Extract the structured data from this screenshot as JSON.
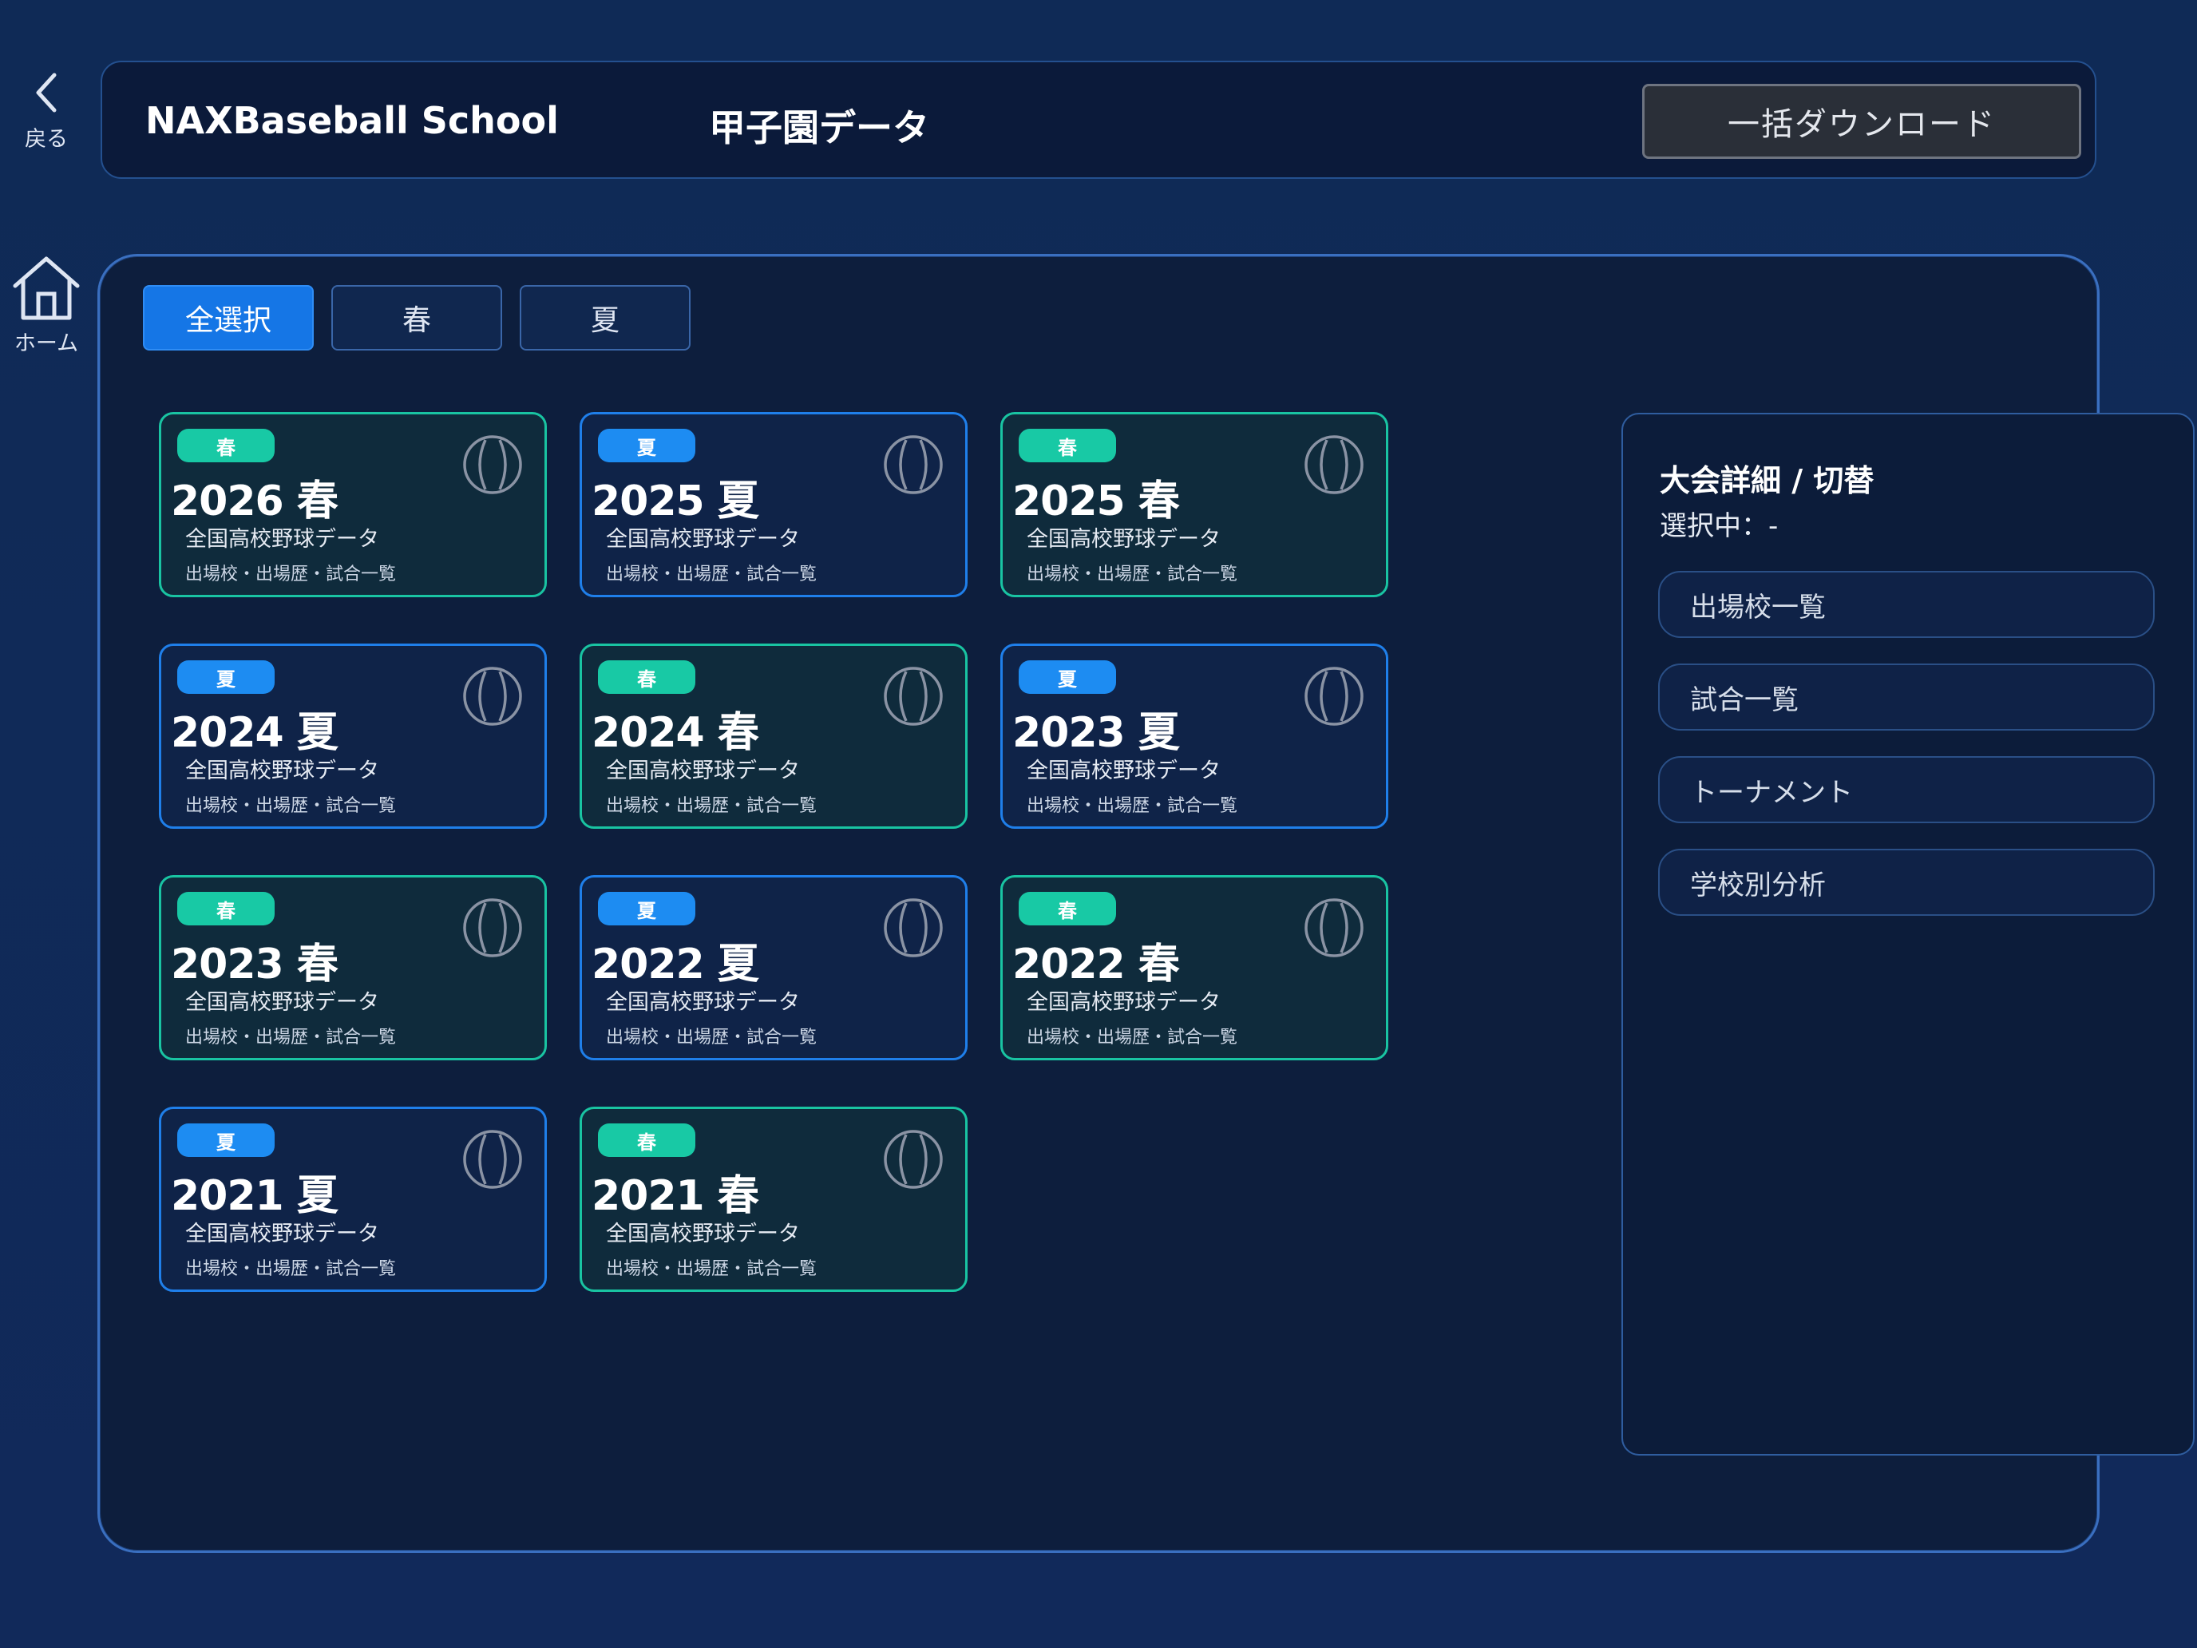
{
  "nav": {
    "back_label": "戻る",
    "home_label": "ホーム"
  },
  "header": {
    "brand": "NAXBaseball School",
    "title": "甲子園データ",
    "download_label": "一括ダウンロード"
  },
  "filters": {
    "all": "全選択",
    "spring": "春",
    "summer": "夏",
    "active": "all"
  },
  "cards": [
    {
      "badge": "春",
      "title": "2026 春",
      "season": "spring",
      "subtitle": "全国高校野球データ",
      "meta": "出場校・出場歴・試合一覧"
    },
    {
      "badge": "夏",
      "title": "2025 夏",
      "season": "summer",
      "subtitle": "全国高校野球データ",
      "meta": "出場校・出場歴・試合一覧"
    },
    {
      "badge": "春",
      "title": "2025 春",
      "season": "spring",
      "subtitle": "全国高校野球データ",
      "meta": "出場校・出場歴・試合一覧"
    },
    {
      "badge": "夏",
      "title": "2024 夏",
      "season": "summer",
      "subtitle": "全国高校野球データ",
      "meta": "出場校・出場歴・試合一覧"
    },
    {
      "badge": "春",
      "title": "2024 春",
      "season": "spring",
      "subtitle": "全国高校野球データ",
      "meta": "出場校・出場歴・試合一覧"
    },
    {
      "badge": "夏",
      "title": "2023 夏",
      "season": "summer",
      "subtitle": "全国高校野球データ",
      "meta": "出場校・出場歴・試合一覧"
    },
    {
      "badge": "春",
      "title": "2023 春",
      "season": "spring",
      "subtitle": "全国高校野球データ",
      "meta": "出場校・出場歴・試合一覧"
    },
    {
      "badge": "夏",
      "title": "2022 夏",
      "season": "summer",
      "subtitle": "全国高校野球データ",
      "meta": "出場校・出場歴・試合一覧"
    },
    {
      "badge": "春",
      "title": "2022 春",
      "season": "spring",
      "subtitle": "全国高校野球データ",
      "meta": "出場校・出場歴・試合一覧"
    },
    {
      "badge": "夏",
      "title": "2021 夏",
      "season": "summer",
      "subtitle": "全国高校野球データ",
      "meta": "出場校・出場歴・試合一覧"
    },
    {
      "badge": "春",
      "title": "2021 春",
      "season": "spring",
      "subtitle": "全国高校野球データ",
      "meta": "出場校・出場歴・試合一覧"
    }
  ],
  "card_icon": "baseball-icon",
  "side": {
    "title": "大会詳細 / 切替",
    "status": "選択中：-",
    "buttons": [
      "出場校一覧",
      "試合一覧",
      "トーナメント",
      "学校別分析"
    ]
  },
  "colors": {
    "background": "#0f2a56",
    "summer_accent": "#1d8cf2",
    "spring_accent": "#18c9a5",
    "filter_active": "#1576e6"
  }
}
